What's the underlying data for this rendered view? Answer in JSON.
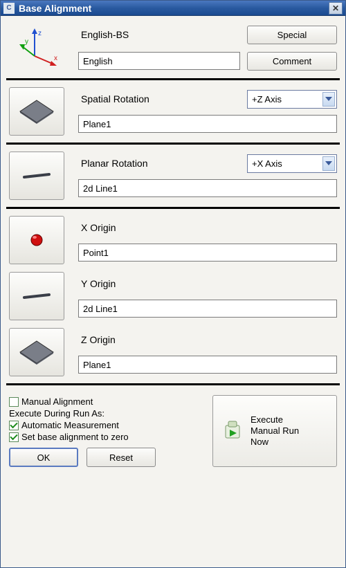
{
  "title": "Base Alignment",
  "header": {
    "subtitle": "English-BS",
    "name_value": "English",
    "special_btn": "Special",
    "comment_btn": "Comment"
  },
  "sections": {
    "spatial": {
      "label": "Spatial Rotation",
      "axis": "+Z Axis",
      "value": "Plane1"
    },
    "planar": {
      "label": "Planar Rotation",
      "axis": "+X Axis",
      "value": "2d Line1"
    },
    "xorigin": {
      "label": "X Origin",
      "value": "Point1"
    },
    "yorigin": {
      "label": "Y Origin",
      "value": "2d Line1"
    },
    "zorigin": {
      "label": "Z Origin",
      "value": "Plane1"
    }
  },
  "footer": {
    "manual_label": "Manual Alignment",
    "manual_checked": false,
    "during_label": "Execute During Run As:",
    "auto_label": "Automatic Measurement",
    "auto_checked": true,
    "zero_label": "Set base alignment to zero",
    "zero_checked": true,
    "exec_line1": "Execute",
    "exec_line2": "Manual Run",
    "exec_line3": "Now",
    "ok": "OK",
    "reset": "Reset"
  }
}
